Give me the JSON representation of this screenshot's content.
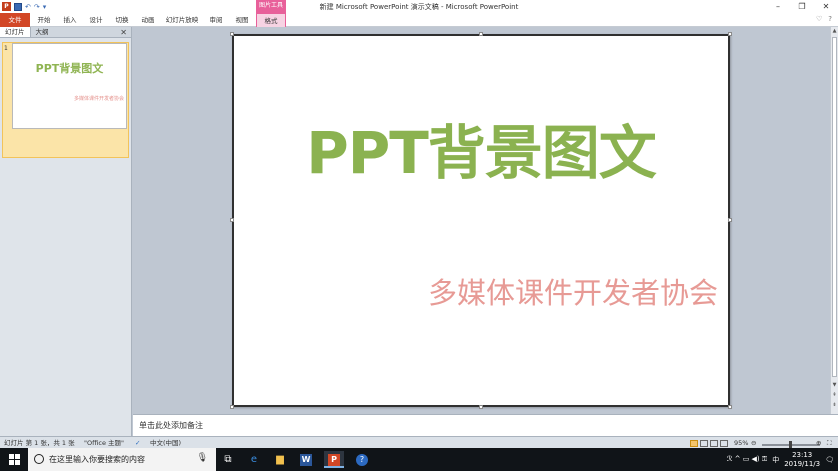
{
  "window": {
    "title": "新建 Microsoft PowerPoint 演示文稿 - Microsoft PowerPoint",
    "contextual_tab_group": "图片工具"
  },
  "qat": {
    "undo_glyph": "↶",
    "redo_glyph": "↷",
    "more_glyph": "▾"
  },
  "ribbon": {
    "tabs": [
      "文件",
      "开始",
      "插入",
      "设计",
      "切换",
      "动画",
      "幻灯片放映",
      "审阅",
      "视图",
      "格式"
    ],
    "help_glyph": "?"
  },
  "leftpane": {
    "tabs": [
      "幻灯片",
      "大纲"
    ],
    "close_glyph": "✕",
    "thumbnail": {
      "number": "1",
      "title": "PPT背景图文",
      "subtitle": "多媒体课件开发者协会"
    }
  },
  "slide": {
    "title": "PPT背景图文",
    "subtitle": "多媒体课件开发者协会",
    "title_color": "#8bb250",
    "subtitle_color": "#e79a95"
  },
  "notes": {
    "placeholder": "单击此处添加备注"
  },
  "statusbar": {
    "slide_info": "幻灯片 第 1 张，共 1 张",
    "theme": "\"Office 主题\"",
    "language": "中文(中国)",
    "zoom": "95%",
    "zoom_out": "⊖",
    "zoom_in": "⊕",
    "fit": "⛶"
  },
  "taskbar": {
    "search_placeholder": "在这里输入你要搜索的内容",
    "time": "23:13",
    "date": "2019/11/3",
    "ime": "中",
    "tray_glyphs": "ℛ ^ ▭ ◀) ⚿"
  },
  "colors": {
    "accent_file_tab": "#d24726",
    "picture_tools": "#e8609a"
  }
}
